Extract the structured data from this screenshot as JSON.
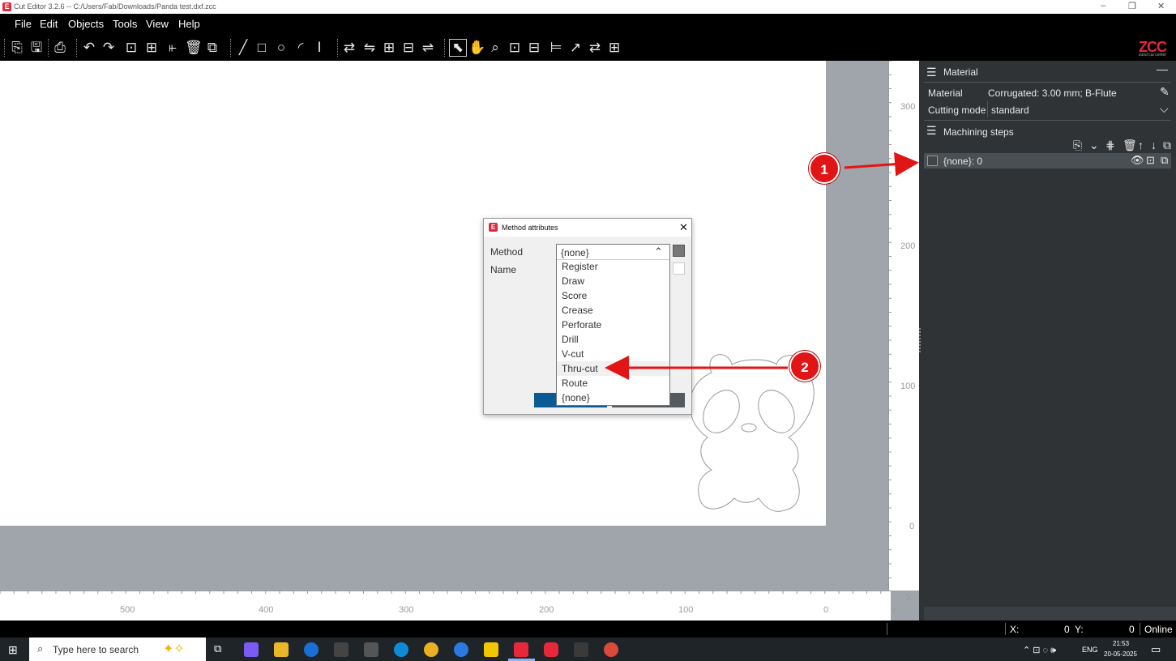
{
  "titlebar": {
    "app_title": "Cut Editor 3.2.6  --  C:/Users/Fab/Downloads/Panda test.dxf.zcc",
    "logo_letter": "E",
    "min": "–",
    "max": "❐",
    "close": "✕"
  },
  "menu": [
    "File",
    "Edit",
    "Objects",
    "Tools",
    "View",
    "Help"
  ],
  "brand": {
    "name": "ZCC",
    "subtitle": "zund cut center",
    "accent": "#e6283a"
  },
  "toolbar_icons": [
    "import-icon",
    "save-icon",
    "export-icon",
    "undo-icon",
    "redo-icon",
    "group-icon",
    "ungroup-icon",
    "align-icon",
    "delete-icon",
    "copy-icon",
    "line-icon",
    "rectangle-icon",
    "circle-icon",
    "arc-icon",
    "text-icon",
    "rotate-left-icon",
    "mirror-icon",
    "array-icon",
    "distribute-icon",
    "weld-icon",
    "select-icon",
    "pan-icon",
    "zoom-icon",
    "zoom-fit-icon",
    "zoom-width-icon",
    "measure-icon",
    "direction-icon",
    "swap-icon",
    "nest-icon"
  ],
  "ruler": {
    "x_labels": [
      "500",
      "400",
      "300",
      "200",
      "100",
      "0"
    ],
    "y_labels": [
      "300",
      "200",
      "100",
      "0"
    ],
    "x_axis": "X",
    "y_axis": "Y"
  },
  "panel": {
    "section_title": "Material",
    "material_label": "Material",
    "material_value": "Corrugated: 3.00 mm; B-Flute",
    "cutting_mode_label": "Cutting mode",
    "cutting_mode_value": "standard",
    "machining_title": "Machining steps",
    "steps": [
      {
        "label": "{none}: 0"
      }
    ]
  },
  "dialog": {
    "title": "Method attributes",
    "method_label": "Method",
    "name_label": "Name",
    "selected": "{none}",
    "options": [
      "Register",
      "Draw",
      "Score",
      "Crease",
      "Perforate",
      "Drill",
      "V-cut",
      "Thru-cut",
      "Route",
      "{none}"
    ],
    "highlighted": "Thru-cut"
  },
  "callouts": [
    "1",
    "2"
  ],
  "status": {
    "x_label": "X:",
    "x_value": "0",
    "y_label": "Y:",
    "y_value": "0",
    "connection": "Online"
  },
  "taskbar": {
    "search_placeholder": "Type here to search",
    "lang": "ENG",
    "time": "21:53",
    "date": "20-05-2025"
  }
}
